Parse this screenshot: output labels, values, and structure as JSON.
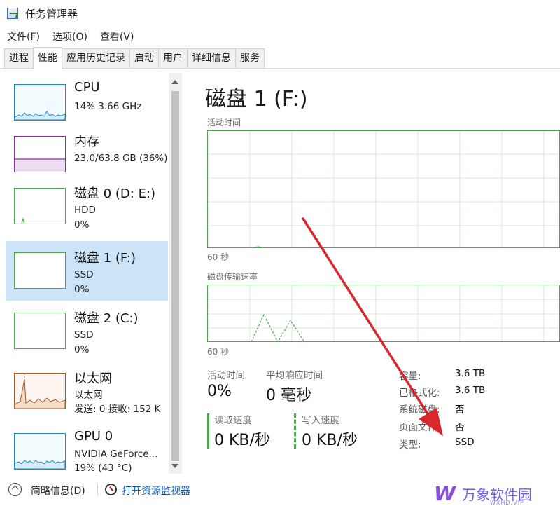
{
  "window": {
    "title": "任务管理器"
  },
  "menu": [
    "文件(F)",
    "选项(O)",
    "查看(V)"
  ],
  "tabs": [
    "进程",
    "性能",
    "应用历史记录",
    "启动",
    "用户",
    "详细信息",
    "服务"
  ],
  "sidebar": {
    "items": [
      {
        "title": "CPU",
        "line1": "14%  3.66 GHz",
        "line2": "",
        "line3": ""
      },
      {
        "title": "内存",
        "line1": "23.0/63.8 GB (36%)",
        "line2": "",
        "line3": ""
      },
      {
        "title": "磁盘 0 (D: E:)",
        "line1": "HDD",
        "line2": "0%",
        "line3": ""
      },
      {
        "title": "磁盘 1 (F:)",
        "line1": "SSD",
        "line2": "0%",
        "line3": ""
      },
      {
        "title": "磁盘 2 (C:)",
        "line1": "SSD",
        "line2": "0%",
        "line3": ""
      },
      {
        "title": "以太网",
        "line1": "以太网",
        "line2": "发送: 0  接收: 152 K",
        "line3": ""
      },
      {
        "title": "GPU 0",
        "line1": "NVIDIA GeForce...",
        "line2": "19% (43 °C)",
        "line3": ""
      }
    ]
  },
  "main": {
    "title": "磁盘 1 (F:)",
    "graph1_label": "活动时间",
    "graph1_time": "60 秒",
    "graph2_label": "磁盘传输速率",
    "graph2_time": "60 秒",
    "stats": {
      "active_time_label": "活动时间",
      "active_time_value": "0%",
      "avg_response_label": "平均响应时间",
      "avg_response_value": "0 毫秒",
      "read_speed_label": "读取速度",
      "read_speed_value": "0 KB/秒",
      "write_speed_label": "写入速度",
      "write_speed_value": "0 KB/秒"
    },
    "properties": [
      {
        "label": "容量:",
        "value": "3.6 TB"
      },
      {
        "label": "已格式化:",
        "value": "3.6 TB"
      },
      {
        "label": "系统磁盘:",
        "value": "否"
      },
      {
        "label": "页面文件:",
        "value": "否"
      },
      {
        "label": "类型:",
        "value": "SSD"
      }
    ]
  },
  "footer": {
    "summary_label": "简略信息(D)",
    "monitor_label": "打开资源监视器"
  },
  "watermark": {
    "logo": "W",
    "text": "万象软件园",
    "sub": "WXHD.VIP"
  },
  "colors": {
    "cpu": "#1d8bc8",
    "memory": "#8b2ea8",
    "disk": "#4da64d",
    "ethernet": "#a65a28",
    "gpu": "#1d8bc8",
    "selected": "#cce4f7",
    "arrow": "#d9272e"
  }
}
